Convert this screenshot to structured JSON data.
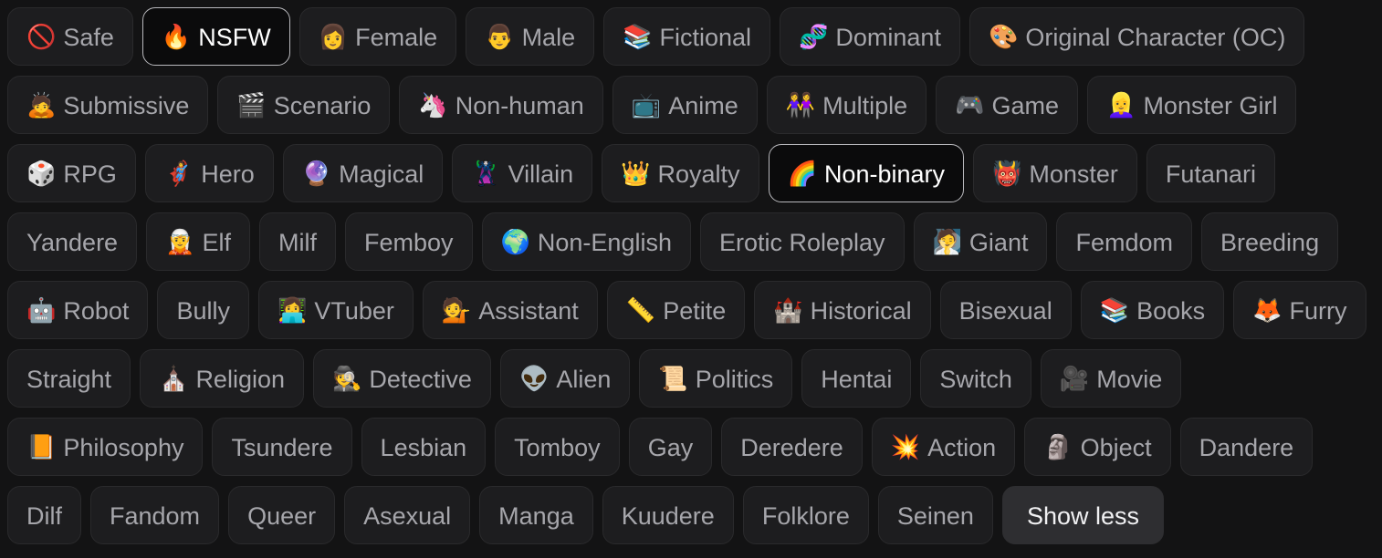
{
  "panel": {
    "name": "character-tag-filter",
    "background_color": "#131314",
    "chip_color": "#1d1d1f",
    "chip_text_color": "#a6a6ab",
    "selected_chip_color": "#0b0b0c",
    "selected_chip_border_color": "#b9b9bd",
    "selected_chip_text_color": "#ffffff",
    "action_chip_color": "#2e2e31"
  },
  "tags": [
    {
      "label": "Safe",
      "emoji": "🚫",
      "icon": "eye-slash-icon",
      "selected": false
    },
    {
      "label": "NSFW",
      "emoji": "🔥",
      "icon": "fire-icon",
      "selected": true
    },
    {
      "label": "Female",
      "emoji": "👩",
      "icon": "woman-icon",
      "selected": false
    },
    {
      "label": "Male",
      "emoji": "👨",
      "icon": "man-icon",
      "selected": false
    },
    {
      "label": "Fictional",
      "emoji": "📚",
      "icon": "books-icon",
      "selected": false
    },
    {
      "label": "Dominant",
      "emoji": "🧬",
      "icon": "dna-icon",
      "selected": false
    },
    {
      "label": "Original Character (OC)",
      "emoji": "🎨",
      "icon": "palette-icon",
      "selected": false
    },
    {
      "label": "Submissive",
      "emoji": "🙇",
      "icon": "bowing-person-icon",
      "selected": false
    },
    {
      "label": "Scenario",
      "emoji": "🎬",
      "icon": "clapper-board-icon",
      "selected": false
    },
    {
      "label": "Non-human",
      "emoji": "🦄",
      "icon": "unicorn-icon",
      "selected": false
    },
    {
      "label": "Anime",
      "emoji": "📺",
      "icon": "television-icon",
      "selected": false
    },
    {
      "label": "Multiple",
      "emoji": "👭",
      "icon": "two-women-icon",
      "selected": false
    },
    {
      "label": "Game",
      "emoji": "🎮",
      "icon": "game-controller-icon",
      "selected": false
    },
    {
      "label": "Monster Girl",
      "emoji": "👱‍♀️",
      "icon": "blond-woman-icon",
      "selected": false
    },
    {
      "label": "RPG",
      "emoji": "🎲",
      "icon": "dice-icon",
      "selected": false
    },
    {
      "label": "Hero",
      "emoji": "🦸‍♀️",
      "icon": "superhero-icon",
      "selected": false
    },
    {
      "label": "Magical",
      "emoji": "🔮",
      "icon": "crystal-ball-icon",
      "selected": false
    },
    {
      "label": "Villain",
      "emoji": "🦹",
      "icon": "supervillain-icon",
      "selected": false
    },
    {
      "label": "Royalty",
      "emoji": "👑",
      "icon": "crown-icon",
      "selected": false
    },
    {
      "label": "Non-binary",
      "emoji": "🌈",
      "icon": "rainbow-icon",
      "selected": true
    },
    {
      "label": "Monster",
      "emoji": "👹",
      "icon": "ogre-icon",
      "selected": false
    },
    {
      "label": "Futanari",
      "emoji": "",
      "icon": "",
      "selected": false
    },
    {
      "label": "Yandere",
      "emoji": "",
      "icon": "",
      "selected": false
    },
    {
      "label": "Elf",
      "emoji": "🧝",
      "icon": "elf-icon",
      "selected": false
    },
    {
      "label": "Milf",
      "emoji": "",
      "icon": "",
      "selected": false
    },
    {
      "label": "Femboy",
      "emoji": "",
      "icon": "",
      "selected": false
    },
    {
      "label": "Non-English",
      "emoji": "🌍",
      "icon": "globe-icon",
      "selected": false
    },
    {
      "label": "Erotic Roleplay",
      "emoji": "",
      "icon": "",
      "selected": false
    },
    {
      "label": "Giant",
      "emoji": "🧖",
      "icon": "person-in-steam-icon",
      "selected": false
    },
    {
      "label": "Femdom",
      "emoji": "",
      "icon": "",
      "selected": false
    },
    {
      "label": "Breeding",
      "emoji": "",
      "icon": "",
      "selected": false
    },
    {
      "label": "Robot",
      "emoji": "🤖",
      "icon": "robot-icon",
      "selected": false
    },
    {
      "label": "Bully",
      "emoji": "",
      "icon": "",
      "selected": false
    },
    {
      "label": "VTuber",
      "emoji": "👩‍💻",
      "icon": "woman-technologist-icon",
      "selected": false
    },
    {
      "label": "Assistant",
      "emoji": "💁",
      "icon": "tipping-hand-icon",
      "selected": false
    },
    {
      "label": "Petite",
      "emoji": "📏",
      "icon": "ruler-icon",
      "selected": false
    },
    {
      "label": "Historical",
      "emoji": "🏰",
      "icon": "castle-icon",
      "selected": false
    },
    {
      "label": "Bisexual",
      "emoji": "",
      "icon": "",
      "selected": false
    },
    {
      "label": "Books",
      "emoji": "📚",
      "icon": "books-icon",
      "selected": false
    },
    {
      "label": "Furry",
      "emoji": "🦊",
      "icon": "fox-icon",
      "selected": false
    },
    {
      "label": "Straight",
      "emoji": "",
      "icon": "",
      "selected": false
    },
    {
      "label": "Religion",
      "emoji": "⛪",
      "icon": "church-icon",
      "selected": false
    },
    {
      "label": "Detective",
      "emoji": "🕵️",
      "icon": "detective-icon",
      "selected": false
    },
    {
      "label": "Alien",
      "emoji": "👽",
      "icon": "alien-icon",
      "selected": false
    },
    {
      "label": "Politics",
      "emoji": "📜",
      "icon": "scroll-icon",
      "selected": false
    },
    {
      "label": "Hentai",
      "emoji": "",
      "icon": "",
      "selected": false
    },
    {
      "label": "Switch",
      "emoji": "",
      "icon": "",
      "selected": false
    },
    {
      "label": "Movie",
      "emoji": "🎥",
      "icon": "movie-camera-icon",
      "selected": false
    },
    {
      "label": "Philosophy",
      "emoji": "📙",
      "icon": "orange-book-icon",
      "selected": false
    },
    {
      "label": "Tsundere",
      "emoji": "",
      "icon": "",
      "selected": false
    },
    {
      "label": "Lesbian",
      "emoji": "",
      "icon": "",
      "selected": false
    },
    {
      "label": "Tomboy",
      "emoji": "",
      "icon": "",
      "selected": false
    },
    {
      "label": "Gay",
      "emoji": "",
      "icon": "",
      "selected": false
    },
    {
      "label": "Deredere",
      "emoji": "",
      "icon": "",
      "selected": false
    },
    {
      "label": "Action",
      "emoji": "💥",
      "icon": "collision-icon",
      "selected": false
    },
    {
      "label": "Object",
      "emoji": "🗿",
      "icon": "moai-icon",
      "selected": false
    },
    {
      "label": "Dandere",
      "emoji": "",
      "icon": "",
      "selected": false
    },
    {
      "label": "Dilf",
      "emoji": "",
      "icon": "",
      "selected": false
    },
    {
      "label": "Fandom",
      "emoji": "",
      "icon": "",
      "selected": false
    },
    {
      "label": "Queer",
      "emoji": "",
      "icon": "",
      "selected": false
    },
    {
      "label": "Asexual",
      "emoji": "",
      "icon": "",
      "selected": false
    },
    {
      "label": "Manga",
      "emoji": "",
      "icon": "",
      "selected": false
    },
    {
      "label": "Kuudere",
      "emoji": "",
      "icon": "",
      "selected": false
    },
    {
      "label": "Folklore",
      "emoji": "",
      "icon": "",
      "selected": false
    },
    {
      "label": "Seinen",
      "emoji": "",
      "icon": "",
      "selected": false
    }
  ],
  "toggle": {
    "label": "Show less"
  }
}
